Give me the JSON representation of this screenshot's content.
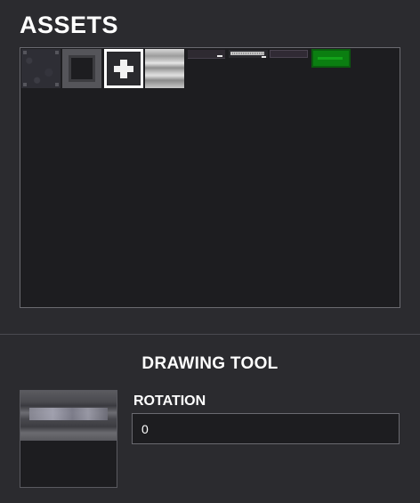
{
  "assets": {
    "title": "ASSETS",
    "tiles": [
      {
        "icon": "dark-stone-texture-icon"
      },
      {
        "icon": "frame-texture-icon"
      },
      {
        "icon": "medkit-plus-icon"
      },
      {
        "icon": "metal-stripes-texture-icon"
      },
      {
        "icon": "dark-slim-bar-icon"
      },
      {
        "icon": "ruler-bar-icon"
      },
      {
        "icon": "plain-slim-bar-icon"
      },
      {
        "icon": "green-block-icon"
      }
    ]
  },
  "drawing_tool": {
    "title": "DRAWING TOOL",
    "preview_icon": "metal-bar-preview-icon",
    "rotation_label": "ROTATION",
    "rotation_value": "0"
  },
  "colors": {
    "background": "#2b2b2f",
    "panel": "#1d1d20",
    "border": "#6a6a70",
    "accent_green": "#0b7e11"
  }
}
